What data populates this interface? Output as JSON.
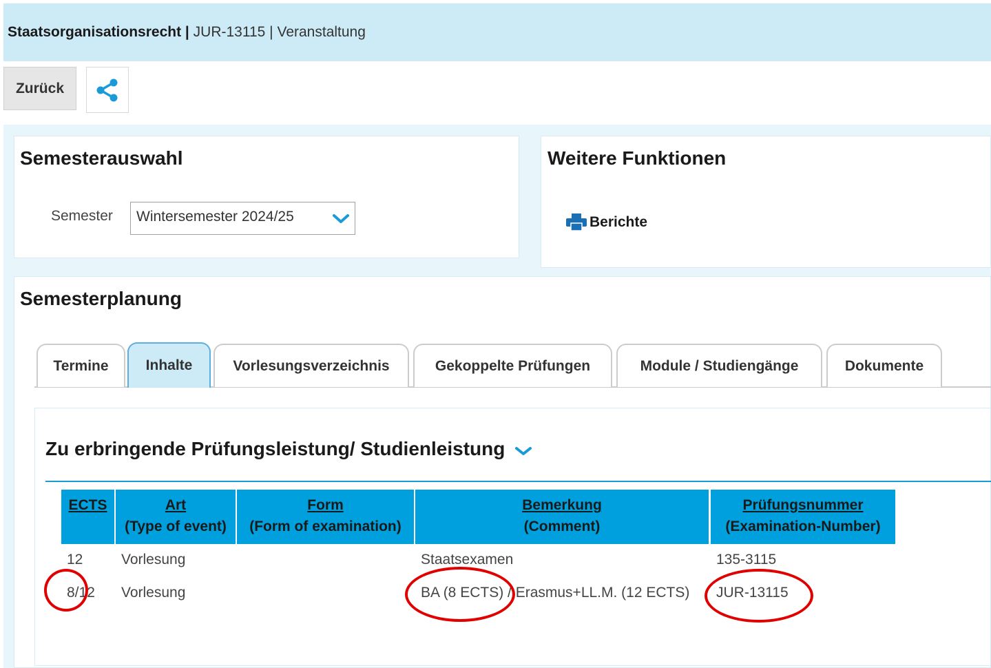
{
  "header": {
    "course_name": "Staatsorganisationsrecht",
    "separator": "|",
    "course_number": "JUR-13115",
    "type": "Veranstaltung"
  },
  "toolbar": {
    "back_label": "Zurück",
    "share_icon": "share-icon"
  },
  "semester_panel": {
    "title": "Semesterauswahl",
    "label": "Semester",
    "selected": "Wintersemester 2024/25"
  },
  "functions_panel": {
    "title": "Weitere Funktionen",
    "report_label": "Berichte",
    "report_icon": "printer-icon"
  },
  "planning": {
    "title": "Semesterplanung",
    "tabs": [
      {
        "label": "Termine",
        "active": false
      },
      {
        "label": "Inhalte",
        "active": true
      },
      {
        "label": "Vorlesungsverzeichnis",
        "active": false
      },
      {
        "label": "Gekoppelte Prüfungen",
        "active": false
      },
      {
        "label": "Module / Studiengänge",
        "active": false
      },
      {
        "label": "Dokumente",
        "active": false
      }
    ]
  },
  "exam_section": {
    "title": "Zu erbringende Prüfungsleistung/ Studienleistung",
    "columns": [
      {
        "line1": "ECTS",
        "line2": ""
      },
      {
        "line1": "Art",
        "line2": "(Type of event)"
      },
      {
        "line1": "Form",
        "line2": "(Form of examination)"
      },
      {
        "line1": "Bemerkung",
        "line2": "(Comment)"
      },
      {
        "line1": "Prüfungsnummer",
        "line2": "(Examination-Number)"
      }
    ],
    "rows": [
      {
        "ects": "12",
        "art": "Vorlesung",
        "form": "",
        "bemerkung": "Staatsexamen",
        "nummer": "135-3115"
      },
      {
        "ects": "8/12",
        "art": "Vorlesung",
        "form": "",
        "bemerkung": "BA (8 ECTS) / Erasmus+LL.M. (12 ECTS)",
        "nummer": "JUR-13115"
      }
    ]
  },
  "colors": {
    "header_bg": "#cdebf6",
    "table_header_bg": "#00a0df",
    "accent_blue": "#1a9bd7",
    "annotation_red": "#e00000"
  }
}
